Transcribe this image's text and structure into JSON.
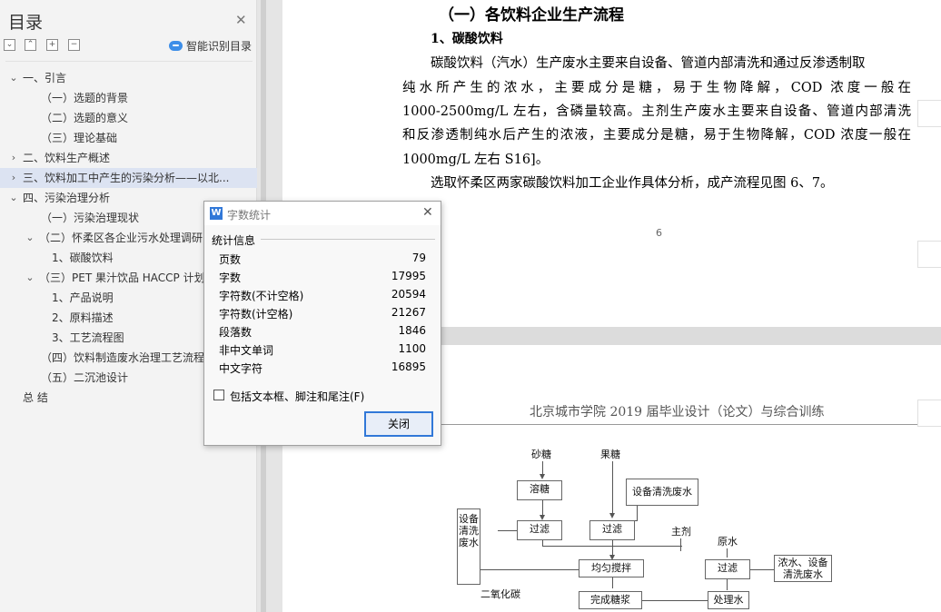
{
  "nav": {
    "title": "目录",
    "smart_toc_label": "智能识别目录",
    "toc": [
      {
        "label": "一、引言",
        "level": 0,
        "expand": "open"
      },
      {
        "label": "（一）选题的背景",
        "level": 2,
        "expand": "none"
      },
      {
        "label": "（二）选题的意义",
        "level": 2,
        "expand": "none"
      },
      {
        "label": "（三）理论基础",
        "level": 2,
        "expand": "none"
      },
      {
        "label": "二、饮料生产概述",
        "level": 0,
        "expand": "closed"
      },
      {
        "label": "三、饮料加工中产生的污染分析——以北...",
        "level": 0,
        "expand": "closed",
        "selected": true
      },
      {
        "label": "四、污染治理分析",
        "level": 0,
        "expand": "open"
      },
      {
        "label": "（一）污染治理现状",
        "level": 2,
        "expand": "none"
      },
      {
        "label": "（二）怀柔区各企业污水处理调研",
        "level": 1,
        "expand": "open"
      },
      {
        "label": "1、碳酸饮料",
        "level": 3,
        "expand": "none"
      },
      {
        "label": "（三）PET 果汁饮品 HACCP 计划",
        "level": 1,
        "expand": "open"
      },
      {
        "label": "1、产品说明",
        "level": 3,
        "expand": "none"
      },
      {
        "label": "2、原料描述",
        "level": 3,
        "expand": "none"
      },
      {
        "label": "3、工艺流程图",
        "level": 3,
        "expand": "none"
      },
      {
        "label": "（四）饮料制造废水治理工艺流程",
        "level": 2,
        "expand": "none"
      },
      {
        "label": "（五）二沉池设计",
        "level": 2,
        "expand": "none"
      },
      {
        "label": "总  结",
        "level": 0.5,
        "expand": "none"
      }
    ]
  },
  "doc": {
    "section_heading": "（一）各饮料企业生产流程",
    "sub_heading": "1、碳酸饮料",
    "paragraph_lines": [
      "碳酸饮料（汽水）生产废水主要来自设备、管道内部清洗和通过反渗透制取",
      "纯水所产生的浓水，主要成分是糖，易于生物降解，COD 浓度一般在",
      "1000-2500mg/L 左右，含磷量较高。主剂生产废水主要来自设备、管道内部清洗",
      "和反渗透制纯水后产生的浓液，主要成分是糖，易于生物降解，COD 浓度一般在",
      "1000mg/L 左右 S16]。",
      "选取怀柔区两家碳酸饮料加工企业作具体分析，成产流程见图 6、7。"
    ],
    "page_number": "6",
    "page2_header": "北京城市学院 2019 届毕业设计（论文）与综合训练",
    "flowchart": {
      "label_sugar": "砂糖",
      "label_fructose": "果糖",
      "box_dissolve": "溶糖",
      "box_equip_wash": "设备清洗废水",
      "box_filter1": "过滤",
      "box_filter2": "过滤",
      "label_main_agent": "主剂",
      "label_raw_water": "原水",
      "box_side_wash": "设备清洗废水",
      "box_mix": "均匀搅拌",
      "box_filter3": "过滤",
      "box_concentrate": "浓水、设备清洗废水",
      "label_co2": "二氧化碳",
      "box_syrup": "完成糖浆",
      "box_treated_water": "处理水"
    }
  },
  "dialog": {
    "title": "字数统计",
    "section_label": "统计信息",
    "stats": [
      {
        "label": "页数",
        "value": "79"
      },
      {
        "label": "字数",
        "value": "17995"
      },
      {
        "label": "字符数(不计空格)",
        "value": "20594"
      },
      {
        "label": "字符数(计空格)",
        "value": "21267"
      },
      {
        "label": "段落数",
        "value": "1846"
      },
      {
        "label": "非中文单词",
        "value": "1100"
      },
      {
        "label": "中文字符",
        "value": "16895"
      }
    ],
    "checkbox_label": "包括文本框、脚注和尾注(F)",
    "checkbox_checked": false,
    "close_button": "关闭",
    "icon_letter": "W"
  }
}
